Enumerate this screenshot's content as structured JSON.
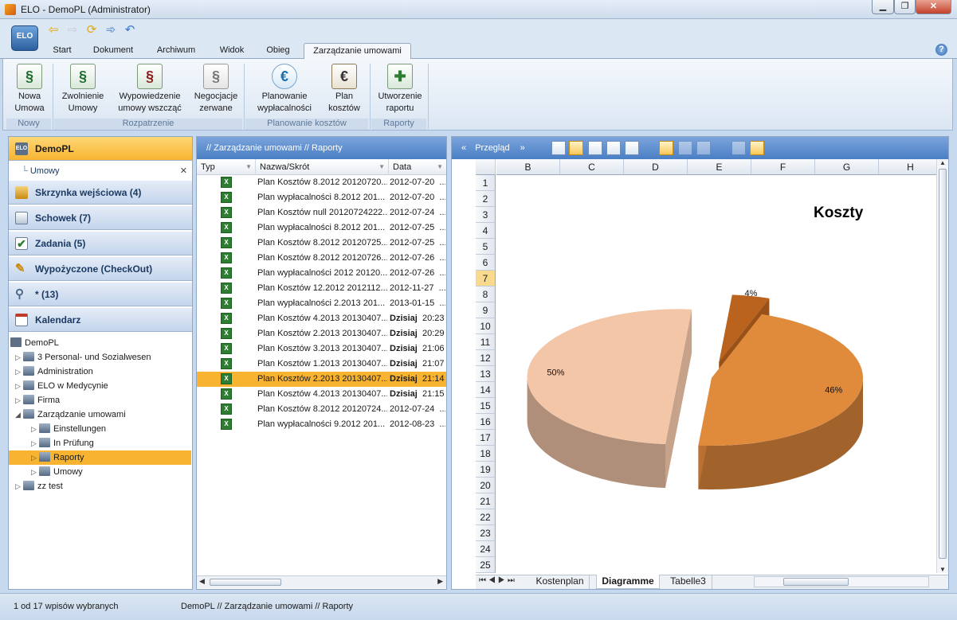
{
  "window": {
    "title": "ELO - DemoPL (Administrator)",
    "min": "▁",
    "max": "❐",
    "close": "✕"
  },
  "app_button": "ELO",
  "ribbon_tabs": [
    "Start",
    "Dokument",
    "Archiwum",
    "Widok",
    "Obieg",
    "Zarządzanie umowami"
  ],
  "help": "?",
  "ribbon": {
    "buttons": [
      {
        "label1": "Nowa",
        "label2": "Umowa",
        "icon": "new-contract-icon"
      },
      {
        "label1": "Zwolnienie",
        "label2": "Umowy",
        "icon": "release-contract-icon"
      },
      {
        "label1": "Wypowiedzenie",
        "label2": "umowy wszcząć",
        "icon": "terminate-contract-icon"
      },
      {
        "label1": "Negocjacje",
        "label2": "zerwane",
        "icon": "negotiation-broken-icon"
      },
      {
        "label1": "Planowanie",
        "label2": "wypłacalności",
        "icon": "solvency-planning-icon"
      },
      {
        "label1": "Plan",
        "label2": "kosztów",
        "icon": "cost-plan-icon"
      },
      {
        "label1": "Utworzenie",
        "label2": "raportu",
        "icon": "create-report-icon"
      }
    ],
    "groups": [
      "Nowy",
      "Rozpatrzenie",
      "Planowanie kosztów",
      "Raporty"
    ]
  },
  "left": {
    "headers": [
      {
        "label": "DemoPL",
        "icon": "elo-icon"
      },
      {
        "label": "Skrzynka wejściowa  (4)",
        "icon": "inbox-icon"
      },
      {
        "label": "Schowek  (7)",
        "icon": "clipboard-icon"
      },
      {
        "label": "Zadania  (5)",
        "icon": "tasks-icon"
      },
      {
        "label": "Wypożyczone (CheckOut)",
        "icon": "pencil-icon"
      },
      {
        "label": "*  (13)",
        "icon": "search-icon"
      },
      {
        "label": "Kalendarz",
        "icon": "calendar-icon"
      }
    ],
    "sub_item": "Umowy",
    "tree": [
      {
        "label": "DemoPL",
        "level": 0
      },
      {
        "label": "3 Personal- und Sozialwesen",
        "level": 1
      },
      {
        "label": "Administration",
        "level": 1
      },
      {
        "label": "ELO w Medycynie",
        "level": 1
      },
      {
        "label": "Firma",
        "level": 1
      },
      {
        "label": "Zarządzanie umowami",
        "level": 1
      },
      {
        "label": "Einstellungen",
        "level": 2
      },
      {
        "label": "In Prüfung",
        "level": 2
      },
      {
        "label": "Raporty",
        "level": 2
      },
      {
        "label": "Umowy",
        "level": 2
      },
      {
        "label": "zz test",
        "level": 1
      }
    ]
  },
  "middle": {
    "breadcrumb": "//  Zarządzanie umowami  //  Raporty",
    "columns": [
      "Typ",
      "Nazwa/Skrót",
      "Data"
    ],
    "rows": [
      {
        "name": "Plan Kosztów 8.2012 20120720...",
        "date": "2012-07-20",
        "time": "..."
      },
      {
        "name": "Plan wypłacalności 8.2012 201...",
        "date": "2012-07-20",
        "time": "..."
      },
      {
        "name": "Plan Kosztów null 20120724222...",
        "date": "2012-07-24",
        "time": "..."
      },
      {
        "name": "Plan wypłacalności 8.2012 201...",
        "date": "2012-07-25",
        "time": "..."
      },
      {
        "name": "Plan Kosztów 8.2012 20120725...",
        "date": "2012-07-25",
        "time": "..."
      },
      {
        "name": "Plan Kosztów 8.2012 20120726...",
        "date": "2012-07-26",
        "time": "..."
      },
      {
        "name": "Plan wypłacalności 2012 20120...",
        "date": "2012-07-26",
        "time": "..."
      },
      {
        "name": "Plan Kosztów 12.2012 2012112...",
        "date": "2012-11-27",
        "time": "..."
      },
      {
        "name": "Plan wypłacalności 2.2013 201...",
        "date": "2013-01-15",
        "time": "..."
      },
      {
        "name": "Plan Kosztów 4.2013 20130407...",
        "date": "Dzisiaj",
        "time": "20:23"
      },
      {
        "name": "Plan Kosztów 2.2013 20130407...",
        "date": "Dzisiaj",
        "time": "20:29"
      },
      {
        "name": "Plan Kosztów 3.2013 20130407...",
        "date": "Dzisiaj",
        "time": "21:06"
      },
      {
        "name": "Plan Kosztów 1.2013 20130407...",
        "date": "Dzisiaj",
        "time": "21:07"
      },
      {
        "name": "Plan Kosztów 2.2013 20130407...",
        "date": "Dzisiaj",
        "time": "21:14"
      },
      {
        "name": "Plan Kosztów 4.2013 20130407...",
        "date": "Dzisiaj",
        "time": "21:15"
      },
      {
        "name": "Plan Kosztów 8.2012 20120724...",
        "date": "2012-07-24",
        "time": "..."
      },
      {
        "name": "Plan wypłacalności 9.2012 201...",
        "date": "2012-08-23",
        "time": "..."
      }
    ]
  },
  "right": {
    "title": "Przegląd",
    "nav_prev": "«",
    "nav_next": "»",
    "columns": [
      "B",
      "C",
      "D",
      "E",
      "F",
      "G",
      "H"
    ],
    "row_numbers": [
      "1",
      "2",
      "3",
      "4",
      "5",
      "6",
      "7",
      "8",
      "9",
      "10",
      "11",
      "12",
      "13",
      "14",
      "15",
      "16",
      "17",
      "18",
      "19",
      "20",
      "21",
      "22",
      "23",
      "24",
      "25"
    ],
    "sheet_tabs": [
      "Kostenplan",
      "Diagramme",
      "Tabelle3"
    ]
  },
  "chart_data": {
    "type": "pie",
    "title": "Koszty",
    "values": [
      50,
      4,
      46
    ],
    "labels": [
      "50%",
      "4%",
      "46%"
    ],
    "colors": [
      "#f3c6a8",
      "#b9631f",
      "#e08a3c"
    ],
    "style": "3d-exploded"
  },
  "status": {
    "selection": "1 od 17 wpisów wybranych",
    "path": "DemoPL // Zarządzanie umowami // Raporty"
  }
}
